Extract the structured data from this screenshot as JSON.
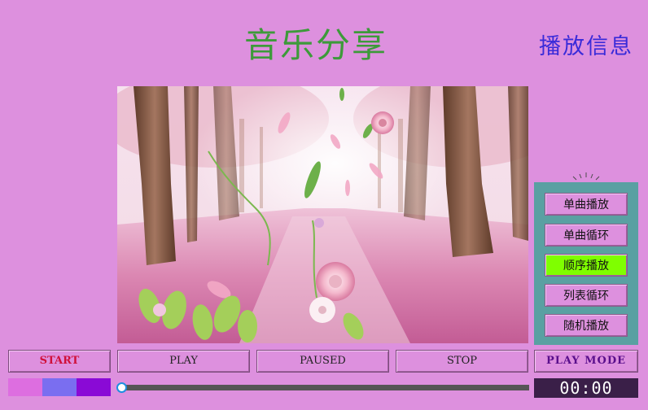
{
  "header": {
    "title": "音乐分享",
    "info_label": "播放信息"
  },
  "cover_image": {
    "icon": "cherry-blossom-forest-scene"
  },
  "play_modes": {
    "items": [
      {
        "label": "单曲播放",
        "active": false
      },
      {
        "label": "单曲循环",
        "active": false
      },
      {
        "label": "顺序播放",
        "active": true
      },
      {
        "label": "列表循环",
        "active": false
      },
      {
        "label": "随机播放",
        "active": false
      }
    ],
    "active_color": "#7fff00"
  },
  "controls": {
    "start": "START",
    "play": "PLAY",
    "paused": "PAUSED",
    "stop": "STOP",
    "play_mode": "PLAY MODE"
  },
  "theme_swatches": [
    "#dd6ee0",
    "#7a6ef0",
    "#8a0ad6"
  ],
  "progress": {
    "value": 0,
    "time": "00:00"
  },
  "colors": {
    "background": "#dd90de",
    "title": "#3d9a3a",
    "info": "#3a2bd9",
    "panel": "#5aa0a2",
    "start_text": "#d0103a"
  }
}
